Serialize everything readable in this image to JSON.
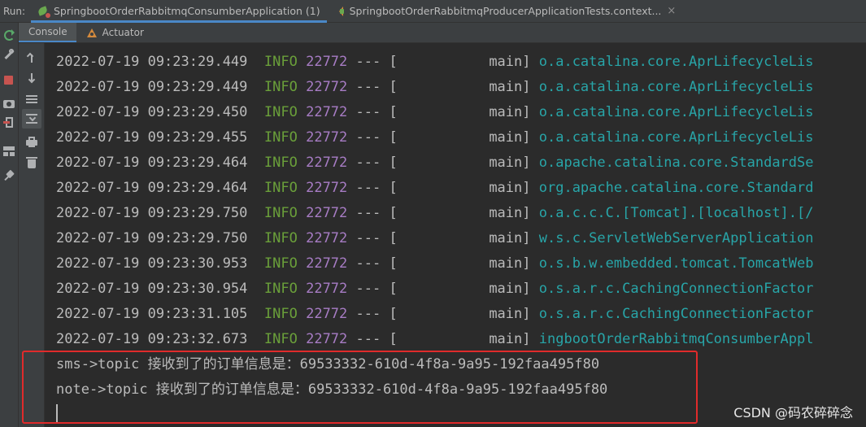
{
  "run_bar": {
    "label": "Run:",
    "tabs": [
      {
        "label": "SpringbootOrderRabbitmqConsumberApplication (1)",
        "icon": "spring-leaf-icon",
        "active": true
      },
      {
        "label": "SpringbootOrderRabbitmqProducerApplicationTests.context...",
        "icon": "test-icon",
        "active": false
      }
    ],
    "close_glyph": "×"
  },
  "sub_tabs": [
    {
      "label": "Console",
      "active": true
    },
    {
      "label": "Actuator",
      "icon": "actuator-icon",
      "active": false
    }
  ],
  "log_lines": [
    {
      "date": "2022-07-19 09:23:29.449",
      "level": "INFO",
      "pid": "22772",
      "sep": "--- [",
      "thread": "main]",
      "logger": "o.a.catalina.core.AprLifecycleLis"
    },
    {
      "date": "2022-07-19 09:23:29.449",
      "level": "INFO",
      "pid": "22772",
      "sep": "--- [",
      "thread": "main]",
      "logger": "o.a.catalina.core.AprLifecycleLis"
    },
    {
      "date": "2022-07-19 09:23:29.450",
      "level": "INFO",
      "pid": "22772",
      "sep": "--- [",
      "thread": "main]",
      "logger": "o.a.catalina.core.AprLifecycleLis"
    },
    {
      "date": "2022-07-19 09:23:29.455",
      "level": "INFO",
      "pid": "22772",
      "sep": "--- [",
      "thread": "main]",
      "logger": "o.a.catalina.core.AprLifecycleLis"
    },
    {
      "date": "2022-07-19 09:23:29.464",
      "level": "INFO",
      "pid": "22772",
      "sep": "--- [",
      "thread": "main]",
      "logger": "o.apache.catalina.core.StandardSe"
    },
    {
      "date": "2022-07-19 09:23:29.464",
      "level": "INFO",
      "pid": "22772",
      "sep": "--- [",
      "thread": "main]",
      "logger": "org.apache.catalina.core.Standard"
    },
    {
      "date": "2022-07-19 09:23:29.750",
      "level": "INFO",
      "pid": "22772",
      "sep": "--- [",
      "thread": "main]",
      "logger": "o.a.c.c.C.[Tomcat].[localhost].[/"
    },
    {
      "date": "2022-07-19 09:23:29.750",
      "level": "INFO",
      "pid": "22772",
      "sep": "--- [",
      "thread": "main]",
      "logger": "w.s.c.ServletWebServerApplication"
    },
    {
      "date": "2022-07-19 09:23:30.953",
      "level": "INFO",
      "pid": "22772",
      "sep": "--- [",
      "thread": "main]",
      "logger": "o.s.b.w.embedded.tomcat.TomcatWeb"
    },
    {
      "date": "2022-07-19 09:23:30.954",
      "level": "INFO",
      "pid": "22772",
      "sep": "--- [",
      "thread": "main]",
      "logger": "o.s.a.r.c.CachingConnectionFactor"
    },
    {
      "date": "2022-07-19 09:23:31.105",
      "level": "INFO",
      "pid": "22772",
      "sep": "--- [",
      "thread": "main]",
      "logger": "o.s.a.r.c.CachingConnectionFactor"
    },
    {
      "date": "2022-07-19 09:23:32.673",
      "level": "INFO",
      "pid": "22772",
      "sep": "--- [",
      "thread": "main]",
      "logger": "ingbootOrderRabbitmqConsumberAppl"
    }
  ],
  "message_lines": [
    {
      "prefix": "sms->topic ",
      "text": "接收到了的订单信息是：",
      "value": "69533332-610d-4f8a-9a95-192faa495f80"
    },
    {
      "prefix": "note->topic ",
      "text": "接收到了的订单信息是：",
      "value": "69533332-610d-4f8a-9a95-192faa495f80"
    }
  ],
  "watermark": "CSDN @码农碎碎念",
  "colors": {
    "background": "#2b2b2b",
    "toolbar": "#3c3f41",
    "info": "#6a9f3a",
    "pid": "#a77cc4",
    "logger": "#28a5a8",
    "text": "#bbbbbb",
    "highlight": "#e02b2b",
    "active_tab_underline": "#4a88c7"
  }
}
